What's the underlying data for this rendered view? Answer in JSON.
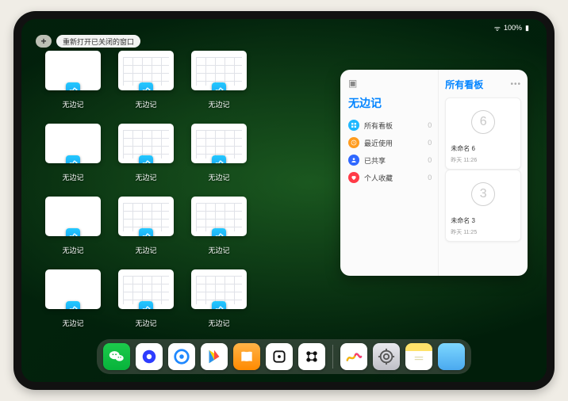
{
  "status": {
    "wifi": "⋮",
    "battery": "100%"
  },
  "toolbar": {
    "plus_glyph": "+",
    "reopen_label": "重新打开已关闭的窗口"
  },
  "app_name": "无边记",
  "thumbnails": [
    {
      "label": "无边记",
      "variant": "blank"
    },
    {
      "label": "无边记",
      "variant": "calendar"
    },
    {
      "label": "无边记",
      "variant": "calendar"
    },
    {
      "label": "无边记",
      "variant": "blank"
    },
    {
      "label": "无边记",
      "variant": "calendar"
    },
    {
      "label": "无边记",
      "variant": "calendar"
    },
    {
      "label": "无边记",
      "variant": "blank"
    },
    {
      "label": "无边记",
      "variant": "calendar"
    },
    {
      "label": "无边记",
      "variant": "calendar"
    },
    {
      "label": "无边记",
      "variant": "blank"
    },
    {
      "label": "无边记",
      "variant": "calendar"
    },
    {
      "label": "无边记",
      "variant": "calendar"
    }
  ],
  "panel": {
    "title": "无边记",
    "right_title": "所有看板",
    "items": [
      {
        "label": "所有看板",
        "count": 0,
        "color": "#1fb8ff",
        "icon": "grid"
      },
      {
        "label": "最近使用",
        "count": 0,
        "color": "#ff9c1f",
        "icon": "clock"
      },
      {
        "label": "已共享",
        "count": 0,
        "color": "#2f68ff",
        "icon": "person"
      },
      {
        "label": "个人收藏",
        "count": 0,
        "color": "#ff3b47",
        "icon": "heart"
      }
    ],
    "boards": [
      {
        "name": "未命名 6",
        "time": "昨天 11:26",
        "glyph": "6"
      },
      {
        "name": "未命名 3",
        "time": "昨天 11:25",
        "glyph": "3"
      }
    ]
  },
  "dock": [
    {
      "name": "wechat",
      "class": "di-wechat"
    },
    {
      "name": "quark",
      "class": "di-quark"
    },
    {
      "name": "browser",
      "class": "di-browser"
    },
    {
      "name": "play",
      "class": "di-play"
    },
    {
      "name": "books",
      "class": "di-books"
    },
    {
      "name": "dice",
      "class": "di-dice"
    },
    {
      "name": "connect",
      "class": "di-connect"
    },
    {
      "name": "sep"
    },
    {
      "name": "freeform",
      "class": "di-freeform"
    },
    {
      "name": "settings",
      "class": "di-settings"
    },
    {
      "name": "notes",
      "class": "di-notes"
    },
    {
      "name": "apps",
      "class": "di-multi"
    }
  ]
}
